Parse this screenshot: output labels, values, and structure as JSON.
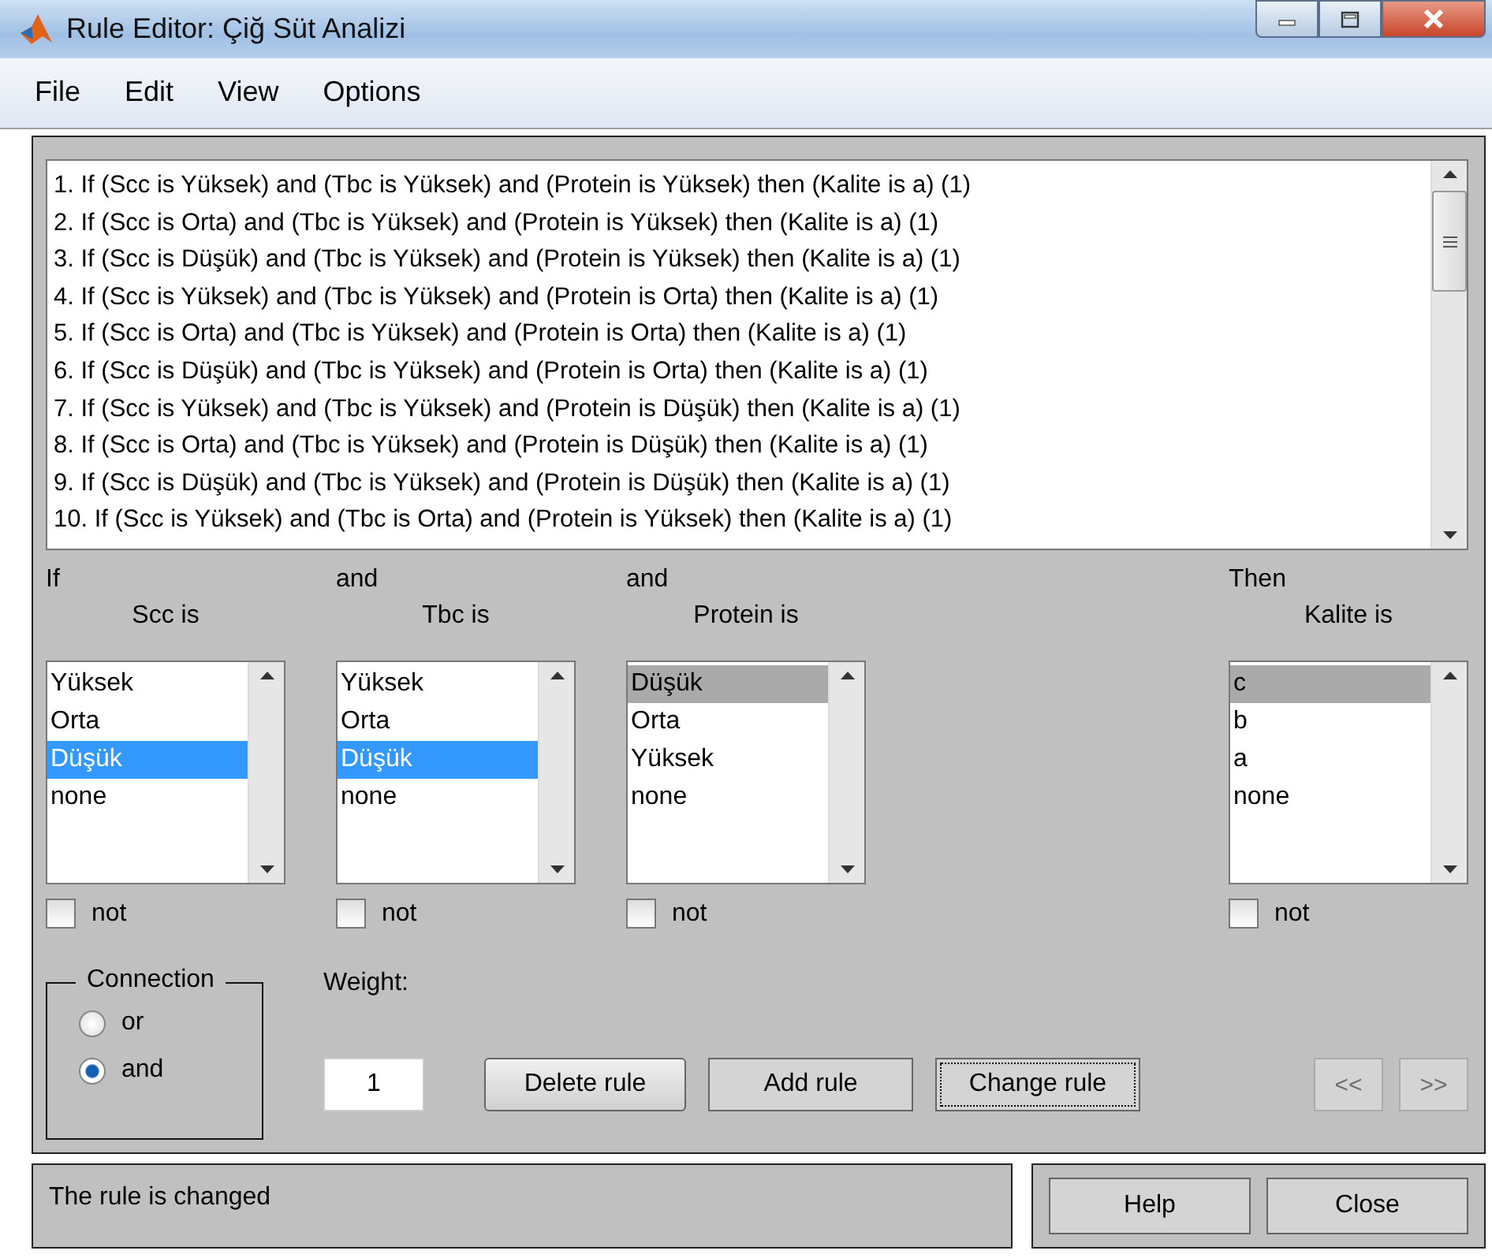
{
  "window": {
    "title": "Rule Editor: Çiğ Süt Analizi"
  },
  "menu": [
    "File",
    "Edit",
    "View",
    "Options"
  ],
  "rules": [
    "1. If (Scc is Yüksek) and (Tbc is Yüksek) and (Protein is Yüksek) then (Kalite is a) (1)",
    "2. If (Scc is Orta) and (Tbc is Yüksek) and (Protein is Yüksek) then (Kalite is a) (1)",
    "3. If (Scc is Düşük) and (Tbc is Yüksek) and (Protein is Yüksek) then (Kalite is a) (1)",
    "4. If (Scc is Yüksek) and (Tbc is Yüksek) and (Protein is Orta) then (Kalite is a) (1)",
    "5. If (Scc is Orta) and (Tbc is Yüksek) and (Protein is Orta) then (Kalite is a) (1)",
    "6. If (Scc is Düşük) and (Tbc is Yüksek) and (Protein is Orta) then (Kalite is a) (1)",
    "7. If (Scc is Yüksek) and (Tbc is Yüksek) and (Protein is Düşük) then (Kalite is a) (1)",
    "8. If (Scc is Orta) and (Tbc is Yüksek) and (Protein is Düşük) then (Kalite is a) (1)",
    "9. If (Scc is Düşük) and (Tbc is Yüksek) and (Protein is Düşük) then (Kalite is a) (1)",
    "10. If (Scc is Yüksek) and (Tbc is Orta) and (Protein is Yüksek) then (Kalite is a) (1)"
  ],
  "variables": [
    {
      "kind": "input",
      "heading": "If",
      "label": "Scc is",
      "focused": true,
      "items": [
        {
          "label": "Yüksek",
          "selected": false
        },
        {
          "label": "Orta",
          "selected": false
        },
        {
          "label": "Düşük",
          "selected": true
        },
        {
          "label": "none",
          "selected": false
        }
      ],
      "not": {
        "label": "not",
        "checked": false
      }
    },
    {
      "kind": "input",
      "heading": "and",
      "label": "Tbc is",
      "focused": true,
      "items": [
        {
          "label": "Yüksek",
          "selected": false
        },
        {
          "label": "Orta",
          "selected": false
        },
        {
          "label": "Düşük",
          "selected": true
        },
        {
          "label": "none",
          "selected": false
        }
      ],
      "not": {
        "label": "not",
        "checked": false
      }
    },
    {
      "kind": "input",
      "heading": "and",
      "label": "Protein is",
      "focused": false,
      "items": [
        {
          "label": "Düşük",
          "selected": true
        },
        {
          "label": "Orta",
          "selected": false
        },
        {
          "label": "Yüksek",
          "selected": false
        },
        {
          "label": "none",
          "selected": false
        }
      ],
      "not": {
        "label": "not",
        "checked": false
      }
    },
    {
      "kind": "output",
      "heading": "Then",
      "label": "Kalite is",
      "focused": false,
      "items": [
        {
          "label": "c",
          "selected": true
        },
        {
          "label": "b",
          "selected": false
        },
        {
          "label": "a",
          "selected": false
        },
        {
          "label": "none",
          "selected": false
        }
      ],
      "not": {
        "label": "not",
        "checked": false
      }
    }
  ],
  "connection": {
    "title": "Connection",
    "options": [
      {
        "label": "or",
        "selected": false
      },
      {
        "label": "and",
        "selected": true
      }
    ]
  },
  "weight": {
    "label": "Weight:",
    "value": "1"
  },
  "buttons": [
    {
      "label": "Delete rule",
      "kind": "raised"
    },
    {
      "label": "Add rule",
      "kind": "flat"
    },
    {
      "label": "Change rule",
      "kind": "focused"
    }
  ],
  "nav_buttons": [
    {
      "label": "<<",
      "disabled": true
    },
    {
      "label": ">>",
      "disabled": true
    }
  ],
  "status": "The rule is changed",
  "footer_buttons": [
    "Help",
    "Close"
  ]
}
